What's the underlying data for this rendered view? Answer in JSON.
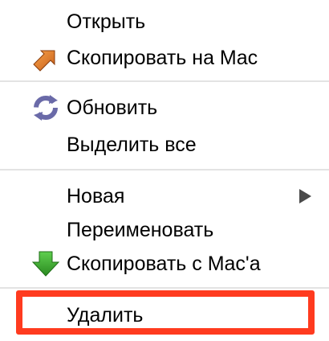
{
  "menu": {
    "items": [
      {
        "label": "Открыть",
        "icon": ""
      },
      {
        "label": "Скопировать на Mac",
        "icon": "copy-to-mac-icon"
      },
      {
        "label": "Обновить",
        "icon": "refresh-icon"
      },
      {
        "label": "Выделить все",
        "icon": ""
      },
      {
        "label": "Новая",
        "icon": "",
        "submenu": true
      },
      {
        "label": "Переименовать",
        "icon": ""
      },
      {
        "label": "Скопировать с Mac'а",
        "icon": "copy-from-mac-icon"
      },
      {
        "label": "Удалить",
        "icon": "",
        "highlighted": true
      }
    ]
  },
  "colors": {
    "highlight_border": "#ff3b1f",
    "separator": "#e3e3e3",
    "copy_to_arrow": "#e0771b",
    "refresh_icon": "#6a6aa8",
    "copy_from_arrow": "#3aa12c"
  }
}
